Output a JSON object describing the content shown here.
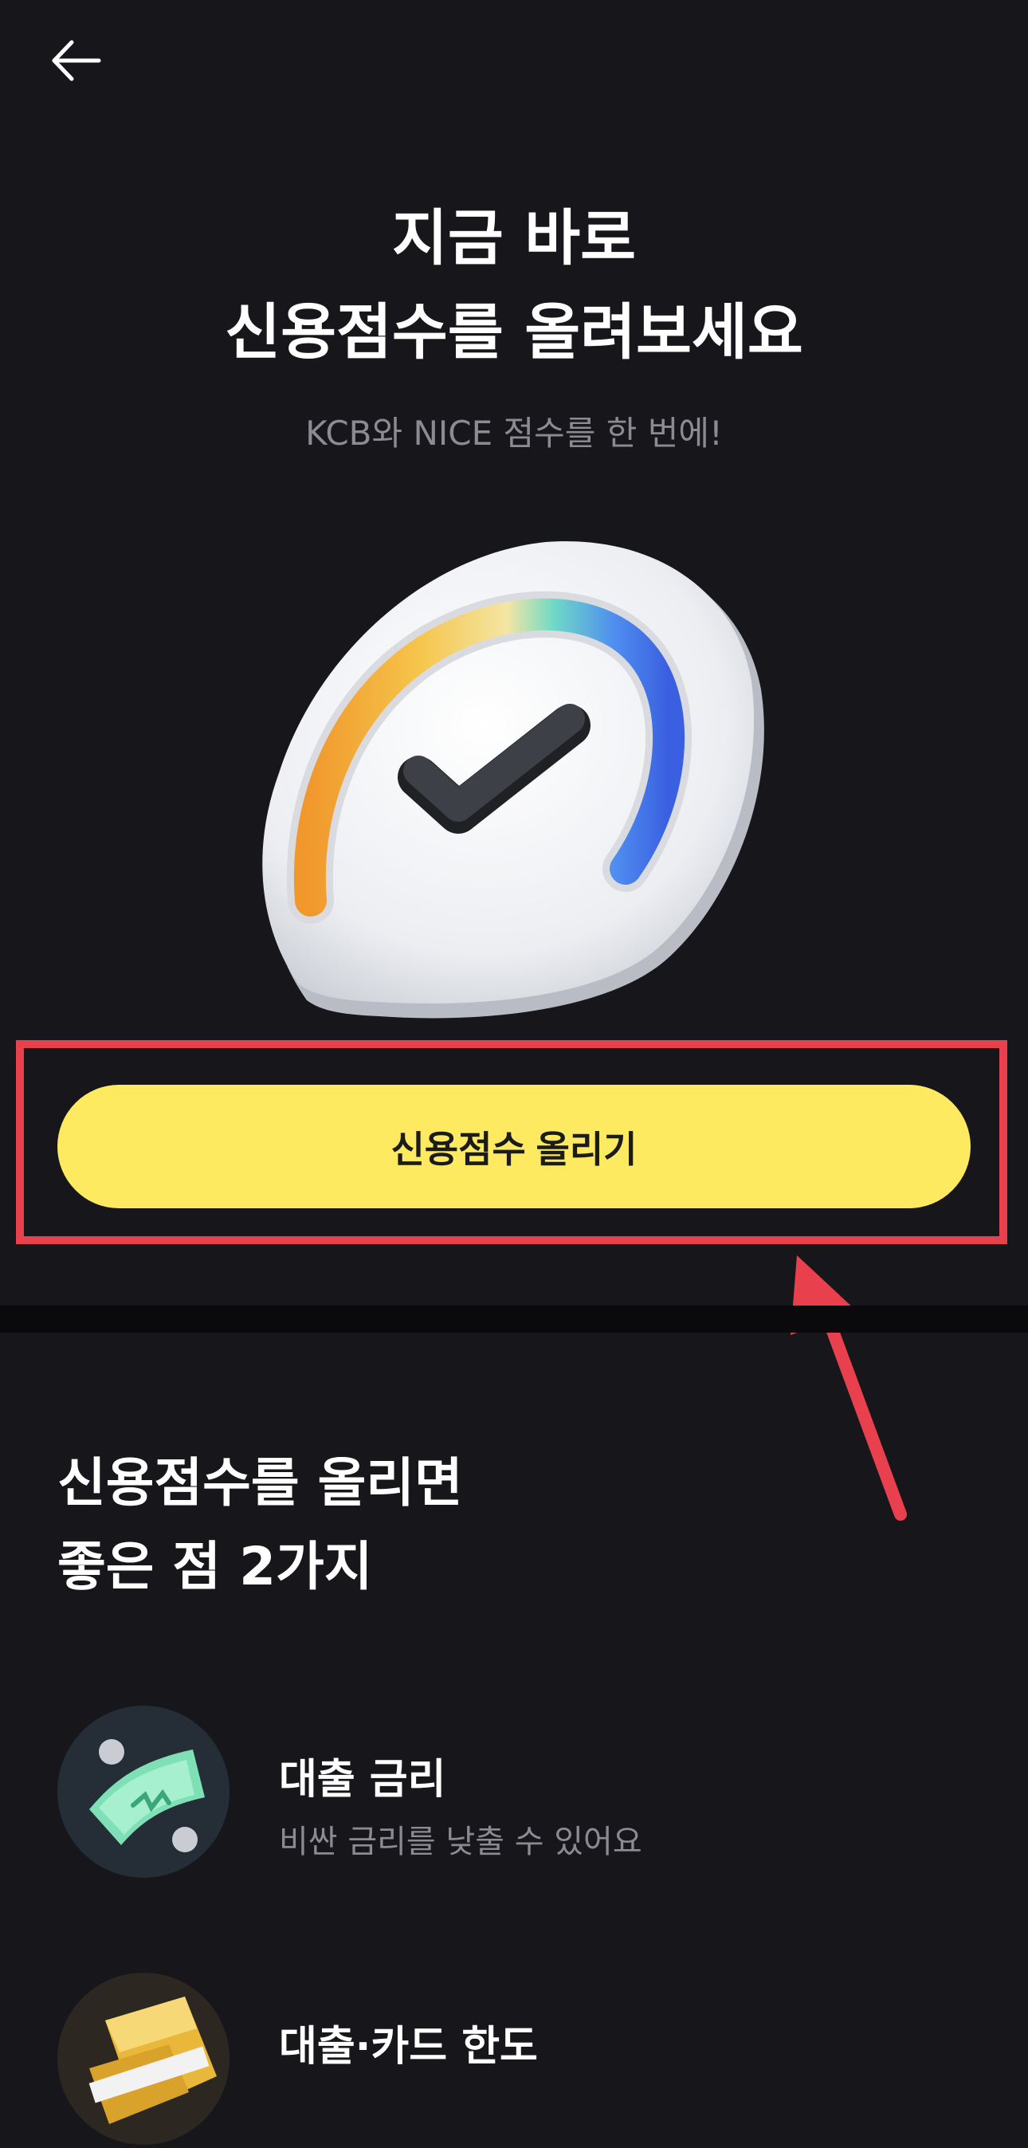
{
  "header": {
    "back_icon": "arrow-left-icon"
  },
  "hero": {
    "title_line1": "지금 바로",
    "title_line2": "신용점수를 올려보세요",
    "subtitle": "KCB와 NICE 점수를 한 번에!",
    "illustration": "credit-gauge-check-icon"
  },
  "cta": {
    "label": "신용점수 올리기",
    "color": "#fdea60"
  },
  "annotation": {
    "color": "#e8404c"
  },
  "benefits": {
    "heading_line1": "신용점수를 올리면",
    "heading_line2": "좋은 점 2가지",
    "items": [
      {
        "title": "대출 금리",
        "description": "비싼 금리를 낮출 수 있어요",
        "icon": "money-bill-icon"
      },
      {
        "title": "대출·카드 한도",
        "description": "",
        "icon": "gold-bar-icon"
      }
    ]
  },
  "colors": {
    "background": "#17171b",
    "divider": "#0a0a0c",
    "muted_text": "#8b8b92"
  }
}
